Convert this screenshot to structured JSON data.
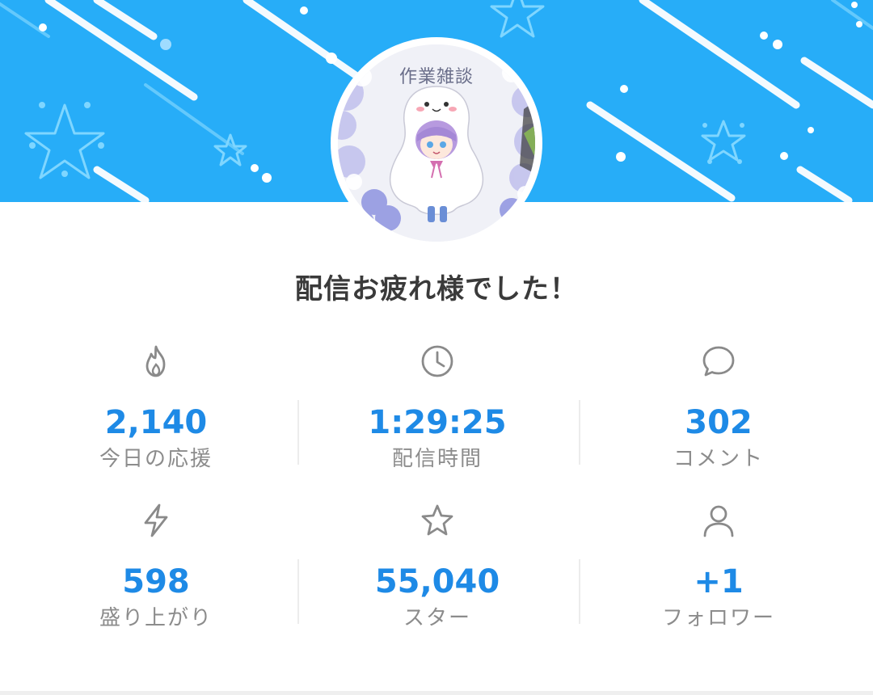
{
  "banner": {
    "color": "#27adf8"
  },
  "avatar": {
    "caption": "作業雑談"
  },
  "headline": "配信お疲れ様でした！",
  "stats": [
    {
      "icon": "flame-icon",
      "value": "2,140",
      "label": "今日の応援"
    },
    {
      "icon": "clock-icon",
      "value": "1:29:25",
      "label": "配信時間"
    },
    {
      "icon": "comment-icon",
      "value": "302",
      "label": "コメント"
    },
    {
      "icon": "lightning-icon",
      "value": "598",
      "label": "盛り上がり"
    },
    {
      "icon": "star-icon",
      "value": "55,040",
      "label": "スター"
    },
    {
      "icon": "person-icon",
      "value": "+1",
      "label": "フォロワー"
    }
  ],
  "colors": {
    "value": "#1e8ae6",
    "label": "#8c8c8c",
    "icon": "#8a8a8a"
  }
}
